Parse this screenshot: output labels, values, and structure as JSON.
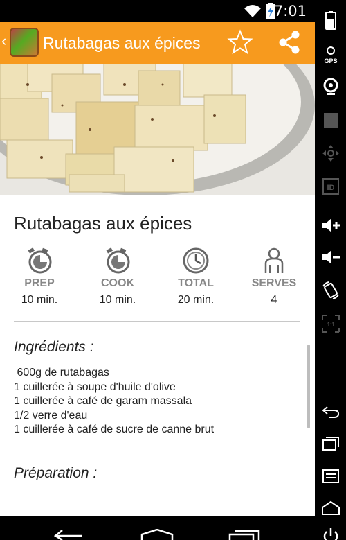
{
  "status_bar": {
    "time": "7:01"
  },
  "action_bar": {
    "title": "Rutabagas aux épices"
  },
  "recipe": {
    "title": "Rutabagas aux épices",
    "stats": [
      {
        "label": "PREP",
        "value": "10 min."
      },
      {
        "label": "COOK",
        "value": "10 min."
      },
      {
        "label": "TOTAL",
        "value": "20 min."
      },
      {
        "label": "SERVES",
        "value": "4"
      }
    ],
    "ingredients_heading": "Ingrédients :",
    "ingredients": [
      " 600g de rutabagas",
      "1 cuillerée à soupe d'huile d'olive",
      "1 cuillerée à café de garam massala",
      "1/2 verre d'eau",
      "1 cuillerée à café de sucre de canne brut"
    ],
    "next_heading": "Préparation :"
  },
  "system_icons": [
    "battery-icon",
    "gps-icon",
    "webcam-icon",
    "clapper-icon",
    "dpad-icon",
    "id-icon",
    "volume-up-icon",
    "volume-down-icon",
    "rotate-icon",
    "scale-icon",
    "back-icon",
    "recent-apps-icon",
    "menu-icon",
    "home-icon",
    "power-icon"
  ],
  "colors": {
    "action_bar": "#f79a1e",
    "stat_label": "#888888"
  }
}
